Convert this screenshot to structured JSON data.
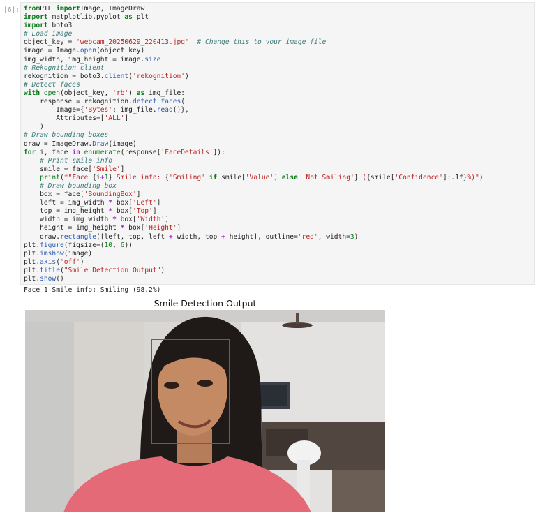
{
  "cell": {
    "prompt": "[6]:",
    "code_lines": [
      [
        [
          "kw",
          "from"
        ],
        [
          "",
          "PIL "
        ],
        [
          "kw",
          "import"
        ],
        [
          "",
          "Image, ImageDraw"
        ]
      ],
      [
        [
          "kw",
          "import"
        ],
        [
          "",
          " matplotlib.pyplot "
        ],
        [
          "kw",
          "as"
        ],
        [
          "",
          " plt"
        ]
      ],
      [
        [
          "kw",
          "import"
        ],
        [
          "",
          " boto3"
        ]
      ],
      [
        [
          "com",
          "# Load image"
        ]
      ],
      [
        [
          "",
          "object_key = "
        ],
        [
          "str",
          "'webcam_20250629_220413.jpg'"
        ],
        [
          "",
          "  "
        ],
        [
          "com",
          "# Change this to your image file"
        ]
      ],
      [
        [
          "",
          "image = Image."
        ],
        [
          "fn",
          "open"
        ],
        [
          "",
          "(object_key)"
        ]
      ],
      [
        [
          "",
          "img_width, img_height = image."
        ],
        [
          "fn",
          "size"
        ]
      ],
      [
        [
          "com",
          "# Rekognition client"
        ]
      ],
      [
        [
          "",
          "rekognition = boto3."
        ],
        [
          "fn",
          "client"
        ],
        [
          "",
          "("
        ],
        [
          "str",
          "'rekognition'"
        ],
        [
          "",
          ")"
        ]
      ],
      [
        [
          "com",
          "# Detect faces"
        ]
      ],
      [
        [
          "kw",
          "with"
        ],
        [
          "",
          ""
        ],
        [
          "bi",
          " open"
        ],
        [
          "",
          "(object_key, "
        ],
        [
          "str",
          "'rb'"
        ],
        [
          "",
          ") "
        ],
        [
          "kw",
          "as"
        ],
        [
          "",
          " img_file:"
        ]
      ],
      [
        [
          "",
          "    response = rekognition."
        ],
        [
          "fn",
          "detect_faces"
        ],
        [
          "",
          "("
        ]
      ],
      [
        [
          "",
          "        Image={"
        ],
        [
          "str",
          "'Bytes'"
        ],
        [
          "",
          ": img_file."
        ],
        [
          "fn",
          "read"
        ],
        [
          "",
          "()},"
        ]
      ],
      [
        [
          "",
          "        Attributes=["
        ],
        [
          "str",
          "'ALL'"
        ],
        [
          "",
          "]"
        ]
      ],
      [
        [
          "",
          "    )"
        ]
      ],
      [
        [
          "com",
          "# Draw bounding boxes"
        ]
      ],
      [
        [
          "",
          "draw = ImageDraw."
        ],
        [
          "fn",
          "Draw"
        ],
        [
          "",
          "(image)"
        ]
      ],
      [
        [
          "kw",
          "for"
        ],
        [
          "",
          " i, face "
        ],
        [
          "op",
          "in"
        ],
        [
          "",
          " "
        ],
        [
          "bi",
          "enumerate"
        ],
        [
          "",
          "(response["
        ],
        [
          "str",
          "'FaceDetails'"
        ],
        [
          "",
          "]):"
        ]
      ],
      [
        [
          "",
          "    "
        ],
        [
          "com",
          "# Print smile info"
        ]
      ],
      [
        [
          "",
          "    smile = face["
        ],
        [
          "str",
          "'Smile'"
        ],
        [
          "",
          "]"
        ]
      ],
      [
        [
          "",
          "    "
        ],
        [
          "bi",
          "print"
        ],
        [
          "",
          "("
        ],
        [
          "str",
          "f\"Face "
        ],
        [
          "",
          "{i"
        ],
        [
          "op",
          "+"
        ],
        [
          "num",
          "1"
        ],
        [
          "",
          "}"
        ],
        [
          "str",
          " Smile info: "
        ],
        [
          "",
          "{"
        ],
        [
          "str",
          "'Smiling'"
        ],
        [
          "",
          " "
        ],
        [
          "kw",
          "if"
        ],
        [
          "",
          " smile["
        ],
        [
          "str",
          "'Value'"
        ],
        [
          "",
          "] "
        ],
        [
          "kw",
          "else"
        ],
        [
          "",
          " "
        ],
        [
          "str",
          "'Not Smiling'"
        ],
        [
          "",
          "}"
        ],
        [
          "str",
          " ("
        ],
        [
          "",
          "{smile["
        ],
        [
          "str",
          "'Confidence'"
        ],
        [
          "",
          "]:.1f}"
        ],
        [
          "str",
          "%)\""
        ],
        [
          "",
          ")"
        ]
      ],
      [
        [
          "",
          "    "
        ],
        [
          "com",
          "# Draw bounding box"
        ]
      ],
      [
        [
          "",
          "    box = face["
        ],
        [
          "str",
          "'BoundingBox'"
        ],
        [
          "",
          "]"
        ]
      ],
      [
        [
          "",
          "    left = img_width "
        ],
        [
          "op",
          "*"
        ],
        [
          "",
          " box["
        ],
        [
          "str",
          "'Left'"
        ],
        [
          "",
          "]"
        ]
      ],
      [
        [
          "",
          "    top = img_height "
        ],
        [
          "op",
          "*"
        ],
        [
          "",
          " box["
        ],
        [
          "str",
          "'Top'"
        ],
        [
          "",
          "]"
        ]
      ],
      [
        [
          "",
          "    width = img_width "
        ],
        [
          "op",
          "*"
        ],
        [
          "",
          " box["
        ],
        [
          "str",
          "'Width'"
        ],
        [
          "",
          "]"
        ]
      ],
      [
        [
          "",
          "    height = img_height "
        ],
        [
          "op",
          "*"
        ],
        [
          "",
          " box["
        ],
        [
          "str",
          "'Height'"
        ],
        [
          "",
          "]"
        ]
      ],
      [
        [
          "",
          "    draw."
        ],
        [
          "fn",
          "rectangle"
        ],
        [
          "",
          "([left, top, left "
        ],
        [
          "op",
          "+"
        ],
        [
          "",
          " width, top "
        ],
        [
          "op",
          "+"
        ],
        [
          "",
          " height], outline="
        ],
        [
          "str",
          "'red'"
        ],
        [
          "",
          ", width="
        ],
        [
          "num",
          "3"
        ],
        [
          "",
          ")"
        ]
      ],
      [
        [
          "",
          "plt."
        ],
        [
          "fn",
          "figure"
        ],
        [
          "",
          "(figsize=("
        ],
        [
          "num",
          "10"
        ],
        [
          "",
          ", "
        ],
        [
          "num",
          "6"
        ],
        [
          "",
          "))"
        ]
      ],
      [
        [
          "",
          "plt."
        ],
        [
          "fn",
          "imshow"
        ],
        [
          "",
          "(image)"
        ]
      ],
      [
        [
          "",
          "plt."
        ],
        [
          "fn",
          "axis"
        ],
        [
          "",
          "("
        ],
        [
          "str",
          "'off'"
        ],
        [
          "",
          ")"
        ]
      ],
      [
        [
          "",
          "plt."
        ],
        [
          "fn",
          "title"
        ],
        [
          "",
          "("
        ],
        [
          "str",
          "\"Smile Detection Output\""
        ],
        [
          "",
          ")"
        ]
      ],
      [
        [
          "",
          "plt."
        ],
        [
          "fn",
          "show"
        ],
        [
          "",
          "()"
        ]
      ]
    ]
  },
  "output": {
    "stdout": "Face 1 Smile info: Smiling (98.2%)",
    "figure_title": "Smile Detection Output",
    "bbox_color": "#d23232"
  }
}
